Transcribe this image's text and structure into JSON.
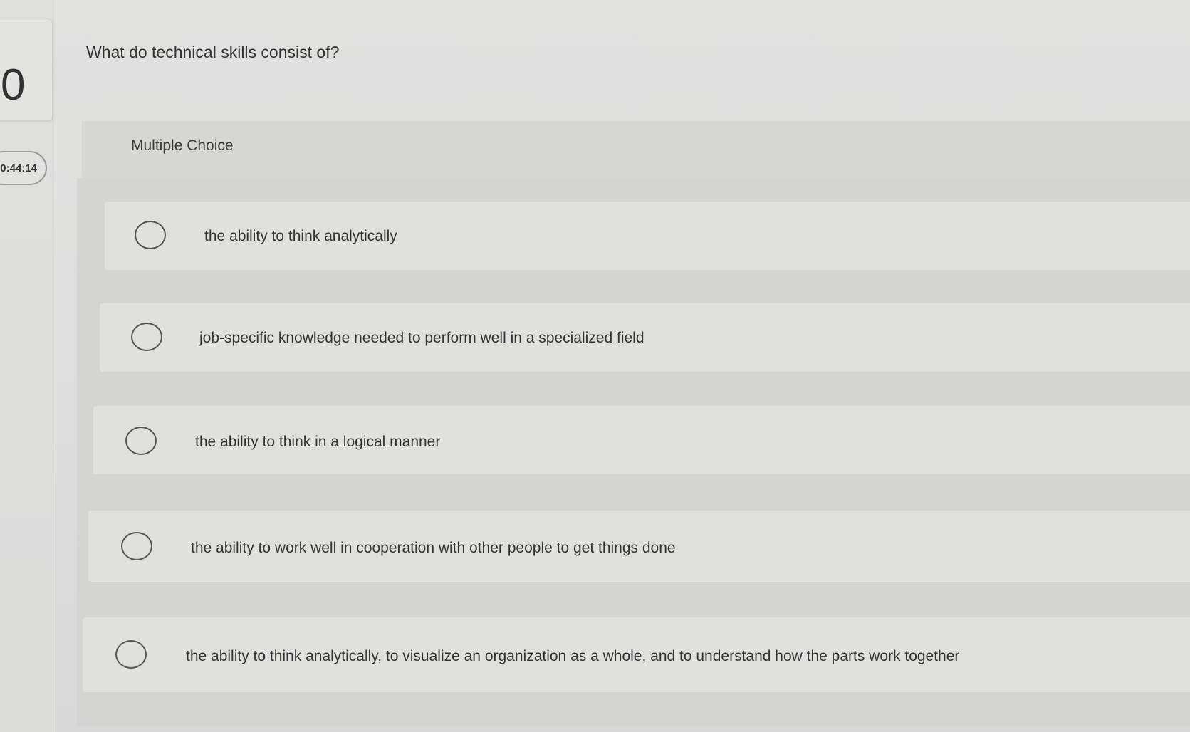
{
  "question_number": "0",
  "timer": "0:44:14",
  "question_text": "What do technical skills consist of?",
  "question_type": "Multiple Choice",
  "options": [
    {
      "label": "the ability to think analytically",
      "selected": false
    },
    {
      "label": "job-specific knowledge needed to perform well in a specialized field",
      "selected": false
    },
    {
      "label": "the ability to think in a logical manner",
      "selected": false
    },
    {
      "label": "the ability to work well in cooperation with other people to get things done",
      "selected": false
    },
    {
      "label": "the ability to think analytically, to visualize an organization as a whole, and to understand how the parts work together",
      "selected": false
    }
  ],
  "icons": {
    "radio": "radio-unselected-icon"
  }
}
